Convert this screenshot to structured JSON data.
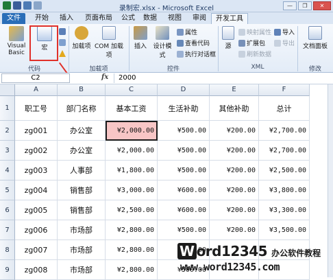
{
  "window": {
    "title": "录制宏.xlsx - Microsoft Excel",
    "buttons": [
      "—",
      "❐",
      "✕"
    ]
  },
  "tabs": [
    "文件",
    "开始",
    "插入",
    "页面布局",
    "公式",
    "数据",
    "视图",
    "审阅",
    "开发工具"
  ],
  "active_tab": "开发工具",
  "ribbon": {
    "code": {
      "visual_basic": "Visual Basic",
      "macro": "宏",
      "group": "代码"
    },
    "addins": {
      "addins": "加载项",
      "com_addins": "COM 加载项",
      "group": "加载项"
    },
    "controls": {
      "insert": "插入",
      "design_mode": "设计模式",
      "properties": "属性",
      "view_code": "查看代码",
      "run_dialog": "执行对话框",
      "group": "控件"
    },
    "xml": {
      "source": "源",
      "map_props": "映射属性",
      "expansion": "扩展包",
      "refresh": "刷新数据",
      "import": "导入",
      "export": "导出",
      "group": "XML"
    },
    "modify": {
      "doc_panel": "文档面板",
      "group": "修改"
    }
  },
  "formula_bar": {
    "name_box": "C2",
    "fx": "fx",
    "value": "2000"
  },
  "columns": [
    "A",
    "B",
    "C",
    "D",
    "E",
    "F"
  ],
  "table": {
    "headers": [
      "职工号",
      "部门名称",
      "基本工资",
      "生活补助",
      "其他补助",
      "总计"
    ],
    "rows": [
      [
        "zg001",
        "办公室",
        "¥2,000.00",
        "¥500.00",
        "¥200.00",
        "¥2,700.00"
      ],
      [
        "zg002",
        "办公室",
        "¥2,000.00",
        "¥500.00",
        "¥200.00",
        "¥2,700.00"
      ],
      [
        "zg003",
        "人事部",
        "¥1,800.00",
        "¥500.00",
        "¥200.00",
        "¥2,500.00"
      ],
      [
        "zg004",
        "销售部",
        "¥3,000.00",
        "¥600.00",
        "¥200.00",
        "¥3,800.00"
      ],
      [
        "zg005",
        "销售部",
        "¥2,500.00",
        "¥600.00",
        "¥200.00",
        "¥3,300.00"
      ],
      [
        "zg006",
        "市场部",
        "¥2,800.00",
        "¥500.00",
        "¥200.00",
        "¥3,500.00"
      ],
      [
        "zg007",
        "市场部",
        "¥2,800.00",
        "¥500.00",
        "",
        ""
      ],
      [
        "zg008",
        "市场部",
        "¥2,800.00",
        "¥500.00",
        "",
        ""
      ]
    ]
  },
  "watermark": {
    "brand_w": "W",
    "brand_rest": "ord12345",
    "brand_sub": "办公软件教程",
    "url": "www.word12345.com"
  },
  "colors": {
    "selected_cell": "#f8c6c6",
    "accent": "#2a6eb8",
    "callout": "#e0302a"
  }
}
